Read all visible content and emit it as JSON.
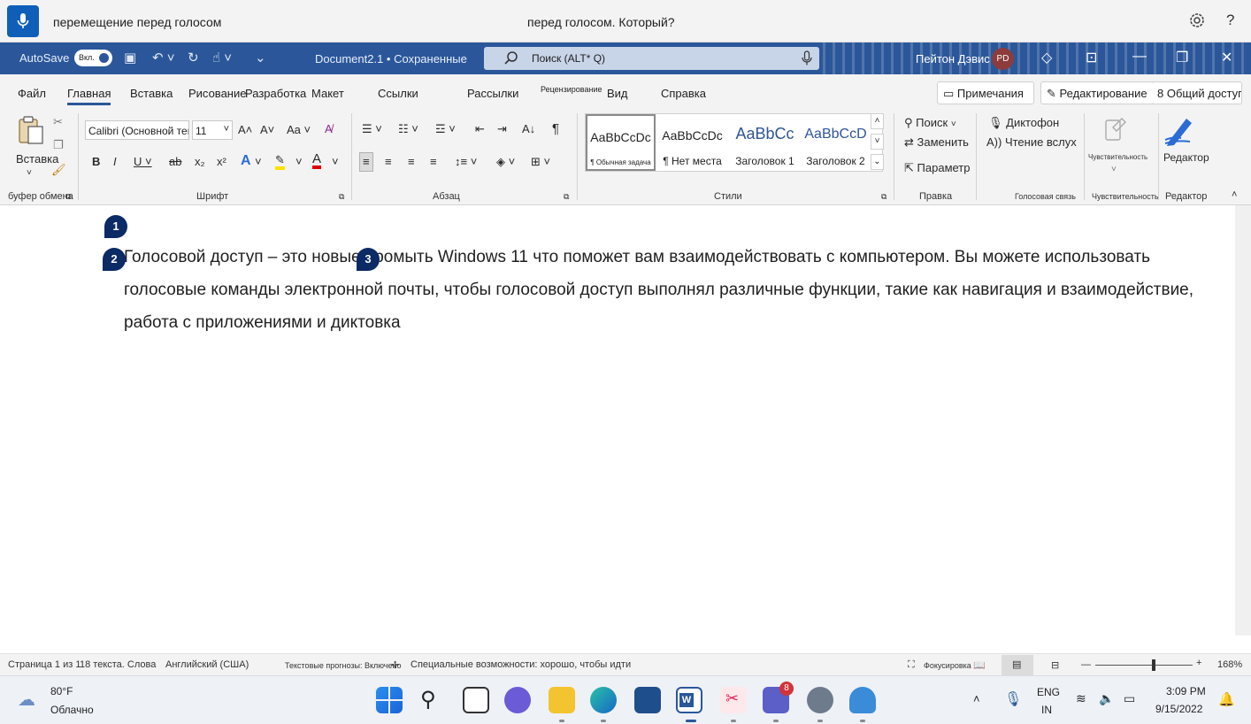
{
  "voice_bar": {
    "command": "перемещение перед голосом",
    "message": "перед голосом. Который?"
  },
  "title_bar": {
    "autosave_label": "AutoSave",
    "autosave_state": "Вкл.",
    "doc_title": "Document2.1 • Сохраненные",
    "search_placeholder": "Поиск (ALT* Q)",
    "user_name": "Пейтон Дэвис",
    "user_initials": "PD"
  },
  "ribbon": {
    "tabs": [
      "Файл",
      "Главная",
      "Вставка",
      "Рисование",
      "Разработка",
      "Макет",
      "Ссылки",
      "Рассылки",
      "Рецензирование",
      "Вид",
      "Справка"
    ],
    "comments_btn": "Примечания",
    "editing_btn": "Редактирование",
    "share_btn": "8 Общий доступ",
    "clipboard": {
      "paste": "Вставка",
      "group": "буфер обмена"
    },
    "font": {
      "name": "Calibri (Основной текст)",
      "size": "11",
      "group": "Шрифт"
    },
    "paragraph": {
      "group": "Абзац"
    },
    "styles": {
      "group": "Стили",
      "items": [
        {
          "sample": "AaBbCcDc",
          "name": "¶ Обычная задача"
        },
        {
          "sample": "AaBbCcDc",
          "name": "¶ Нет места"
        },
        {
          "sample": "AaBbCc",
          "name": "Заголовок 1"
        },
        {
          "sample": "AaBbCcD",
          "name": "Заголовок 2"
        }
      ]
    },
    "editing": {
      "find": "Поиск",
      "replace": "Заменить",
      "select": "Параметр",
      "group": "Правка"
    },
    "voice": {
      "dictate": "Диктофон",
      "read_aloud": "A)) Чтение вслух",
      "group": "Голосовая связь"
    },
    "sensitivity": {
      "label": "Чувствительность",
      "group": "Чувствительность"
    },
    "editor": {
      "label": "Редактор",
      "group": "Редактор"
    }
  },
  "document": {
    "paragraph_line1": "Голосовой доступ – это новые промыть Windows 11 что поможет вам взаимодействовать с компьютером. Вы можете использовать",
    "paragraph_line2": "голосовые команды электронной почты, чтобы голосовой доступ выполнял различные функции, такие как навигация и взаимодействие,",
    "paragraph_line3": "работа с приложениями и диктовка",
    "markers": [
      "1",
      "2",
      "3"
    ]
  },
  "status_bar": {
    "page": "Страница 1 из 1",
    "words": "18 текста. Слова",
    "language": "Английский (США)",
    "predictions": "Текстовые прогнозы: Включено",
    "accessibility": "Специальные возможности: хорошо, чтобы идти",
    "focus": "Фокусировка",
    "zoom": "168%",
    "zoom_level": 0.6
  },
  "taskbar": {
    "weather_temp": "80°F",
    "weather_desc": "Облачно",
    "teams_badge": "8",
    "lang": "ENG",
    "lang_sub": "IN",
    "time": "3:09 PM",
    "date": "9/15/2022"
  }
}
